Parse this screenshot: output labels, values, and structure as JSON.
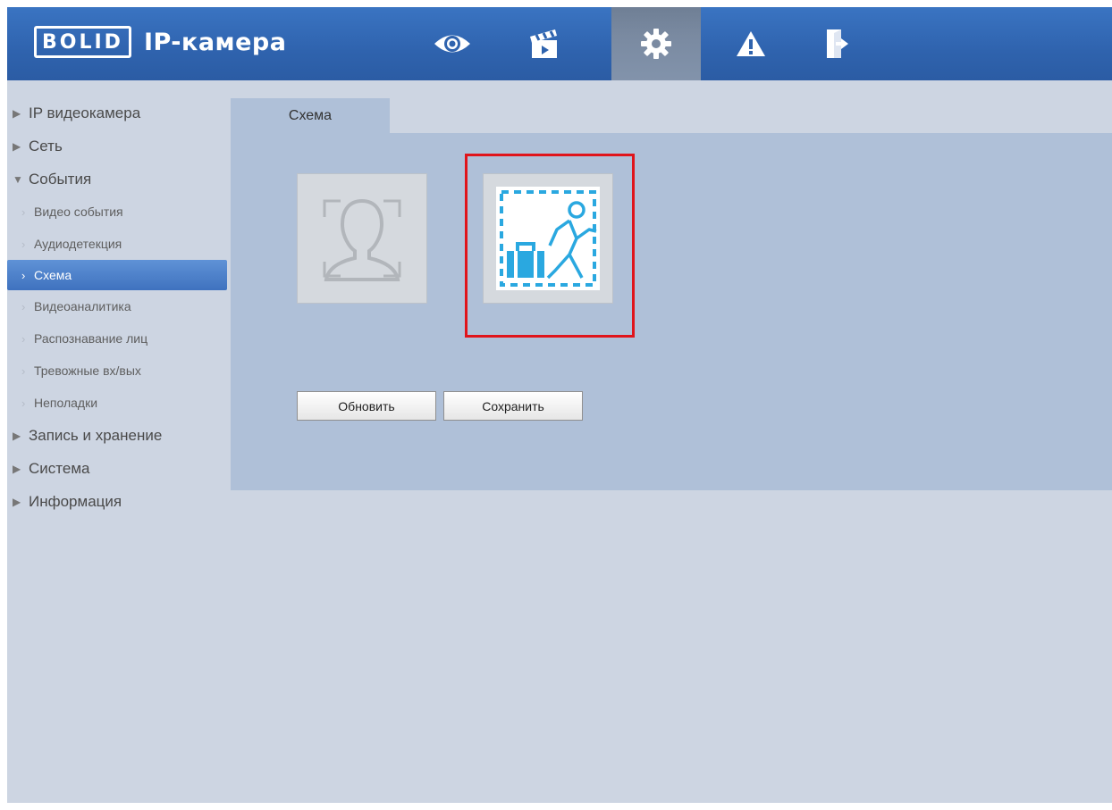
{
  "header": {
    "logo_text": "BOLID",
    "app_title": "IP-камера",
    "nav": [
      {
        "icon": "eye-icon"
      },
      {
        "icon": "clapperboard-icon"
      },
      {
        "icon": "gear-icon",
        "active": true
      },
      {
        "icon": "warning-icon"
      },
      {
        "icon": "logout-icon"
      }
    ]
  },
  "sidebar": {
    "items": [
      {
        "label": "IP видеокамера",
        "expanded": false
      },
      {
        "label": "Сеть",
        "expanded": false
      },
      {
        "label": "События",
        "expanded": true
      },
      {
        "label": "Запись и хранение",
        "expanded": false
      },
      {
        "label": "Система",
        "expanded": false
      },
      {
        "label": "Информация",
        "expanded": false
      }
    ],
    "events_children": [
      {
        "label": "Видео события"
      },
      {
        "label": "Аудиодетекция"
      },
      {
        "label": "Схема",
        "active": true
      },
      {
        "label": "Видеоаналитика"
      },
      {
        "label": "Распознавание лиц"
      },
      {
        "label": "Тревожные вх/вых"
      },
      {
        "label": "Неполадки"
      }
    ]
  },
  "main": {
    "tab_label": "Схема",
    "schemes": [
      {
        "icon": "face-recognition-icon",
        "selected": false
      },
      {
        "icon": "abandoned-object-icon",
        "selected": true
      }
    ],
    "buttons": {
      "refresh": "Обновить",
      "save": "Сохранить"
    }
  },
  "colors": {
    "header": "#2f63ae",
    "sidebar_active": "#3f72bf",
    "highlight": "#e0141b",
    "scheme_accent": "#2aa8e0"
  }
}
